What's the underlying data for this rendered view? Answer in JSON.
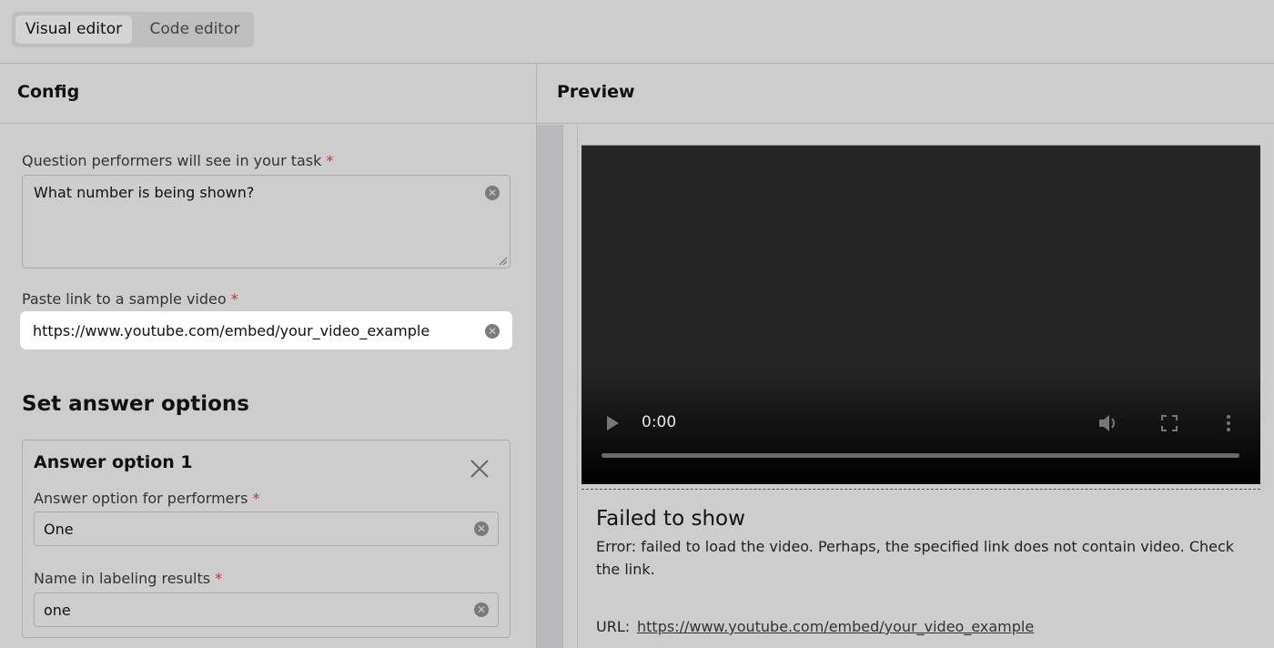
{
  "toolbar": {
    "visual_editor": "Visual editor",
    "code_editor": "Code editor"
  },
  "config": {
    "title": "Config",
    "question": {
      "label": "Question performers will see in your task",
      "value": "What number is being shown?"
    },
    "video": {
      "label": "Paste link to a sample video",
      "value": "https://www.youtube.com/embed/your_video_example"
    },
    "answers_heading": "Set answer options",
    "answer1": {
      "title": "Answer option 1",
      "option_label": "Answer option for performers",
      "option_value": "One",
      "name_label": "Name in labeling results",
      "name_value": "one"
    },
    "required_mark": "*"
  },
  "preview": {
    "title": "Preview",
    "time": "0:00",
    "error_title": "Failed to show",
    "error_message": "Error: failed to load the video. Perhaps, the specified link does not contain video. Check the link.",
    "url_label": "URL:",
    "url_value": "https://www.youtube.com/embed/your_video_example"
  },
  "colors": {
    "background": "#cdcdcd",
    "required": "#c8322d",
    "video_bg": "#262626"
  },
  "icons": [
    "clear-icon",
    "close-icon",
    "play-icon",
    "volume-icon",
    "fullscreen-icon",
    "more-icon"
  ]
}
